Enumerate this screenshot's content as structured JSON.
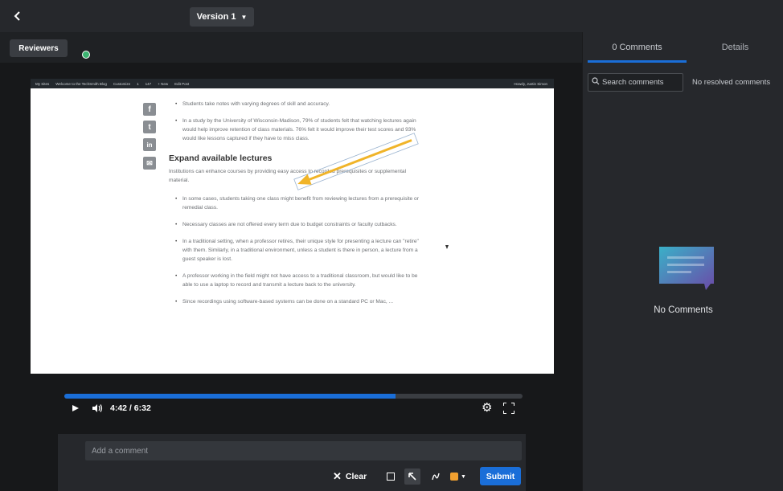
{
  "topbar": {
    "back_icon": "chevron-left-icon",
    "version_label": "Version 1",
    "version_caret": "▼"
  },
  "reviewers": {
    "label": "Reviewers",
    "status_color": "#3cb371"
  },
  "webpage": {
    "admin_bar": [
      "My Sites",
      "Welcome to the TechSmith Blog",
      "Customize",
      "1",
      "147",
      "+ New",
      "Edit Post",
      "Howdy, Justin Simon"
    ],
    "social_icons": [
      "f",
      "t",
      "in",
      "✉"
    ],
    "bullets_top": [
      "Students take notes with varying degrees of skill and accuracy.",
      "In a study by the University of Wisconsin-Madison, 79% of students felt that watching lectures again would help improve retention of class materials. 76% felt it would improve their test scores and 93% would like lessons captured if they have to miss class."
    ],
    "heading": "Expand available lectures",
    "intro": "Institutions can enhance courses by providing easy access to recorded prerequisites or supplemental material.",
    "bullets": [
      "In some cases, students taking one class might benefit from reviewing lectures from a prerequisite or remedial class.",
      "Necessary classes are not offered every term due to budget constraints or faculty cutbacks.",
      "In a traditional setting, when a professor retires, their unique style for presenting a lecture can \"retire\" with them. Similarly, in a traditional environment, unless a student is there in person, a lecture from a guest speaker is lost.",
      "A professor working in the field might not have access to a traditional classroom, but would like to be able to use a laptop to record and transmit a lecture back to the university.",
      "Since recordings using software-based systems can be done on a standard PC or Mac, ..."
    ],
    "annotation_color": "#f0b429"
  },
  "player": {
    "time": "4:42 / 6:32",
    "progress": 0.723,
    "accent": "#1a6ed8"
  },
  "composer": {
    "placeholder": "Add a comment",
    "clear_label": "Clear",
    "clear_icon": "x-icon",
    "submit_label": "Submit",
    "tool_color": "#f0a030"
  },
  "panel": {
    "tabs": [
      "0 Comments",
      "Details"
    ],
    "search_placeholder": "Search comments",
    "resolved_label": "No resolved comments",
    "empty_label": "No Comments"
  }
}
